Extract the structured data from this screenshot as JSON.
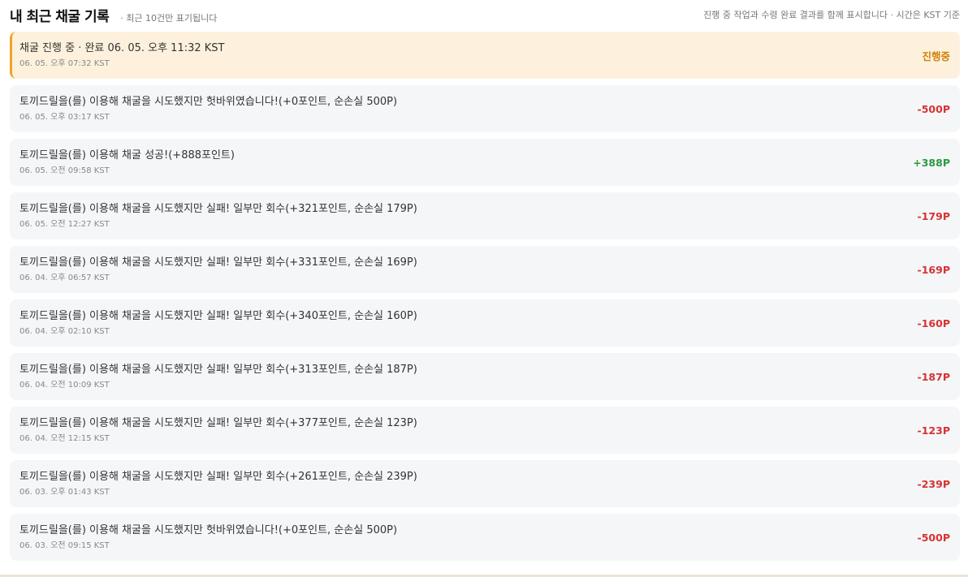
{
  "header": {
    "title": "내 최근 채굴 기록",
    "subtitle": "· 최근 10건만 표기됩니다",
    "note": "진행 중 작업과 수령 완료 결과를 함께 표시합니다 · 시간은 KST 기준"
  },
  "records": [
    {
      "message": "채굴 진행 중 · 완료 06. 05. 오후 11:32 KST",
      "time": "06. 05. 오후 07:32 KST",
      "amount": "진행중",
      "status": "pending"
    },
    {
      "message": "토끼드릴을(를) 이용해 채굴을 시도했지만 헛바위였습니다!(+0포인트, 순손실 500P)",
      "time": "06. 05. 오후 03:17 KST",
      "amount": "-500P",
      "status": "negative"
    },
    {
      "message": "토끼드릴을(를) 이용해 채굴 성공!(+888포인트)",
      "time": "06. 05. 오전 09:58 KST",
      "amount": "+388P",
      "status": "positive"
    },
    {
      "message": "토끼드릴을(를) 이용해 채굴을 시도했지만 실패! 일부만 회수(+321포인트, 순손실 179P)",
      "time": "06. 05. 오전 12:27 KST",
      "amount": "-179P",
      "status": "negative"
    },
    {
      "message": "토끼드릴을(를) 이용해 채굴을 시도했지만 실패! 일부만 회수(+331포인트, 순손실 169P)",
      "time": "06. 04. 오후 06:57 KST",
      "amount": "-169P",
      "status": "negative"
    },
    {
      "message": "토끼드릴을(를) 이용해 채굴을 시도했지만 실패! 일부만 회수(+340포인트, 순손실 160P)",
      "time": "06. 04. 오후 02:10 KST",
      "amount": "-160P",
      "status": "negative"
    },
    {
      "message": "토끼드릴을(를) 이용해 채굴을 시도했지만 실패! 일부만 회수(+313포인트, 순손실 187P)",
      "time": "06. 04. 오전 10:09 KST",
      "amount": "-187P",
      "status": "negative"
    },
    {
      "message": "토끼드릴을(를) 이용해 채굴을 시도했지만 실패! 일부만 회수(+377포인트, 순손실 123P)",
      "time": "06. 04. 오전 12:15 KST",
      "amount": "-123P",
      "status": "negative"
    },
    {
      "message": "토끼드릴을(를) 이용해 채굴을 시도했지만 실패! 일부만 회수(+261포인트, 순손실 239P)",
      "time": "06. 03. 오후 01:43 KST",
      "amount": "-239P",
      "status": "negative"
    },
    {
      "message": "토끼드릴을(를) 이용해 채굴을 시도했지만 헛바위였습니다!(+0포인트, 순손실 500P)",
      "time": "06. 03. 오전 09:15 KST",
      "amount": "-500P",
      "status": "negative"
    }
  ],
  "colors": {
    "pending": "#d4810a",
    "negative": "#d63333",
    "positive": "#2a9a3e",
    "active_bg": "#fdf1dd",
    "active_border": "#f0a326"
  }
}
